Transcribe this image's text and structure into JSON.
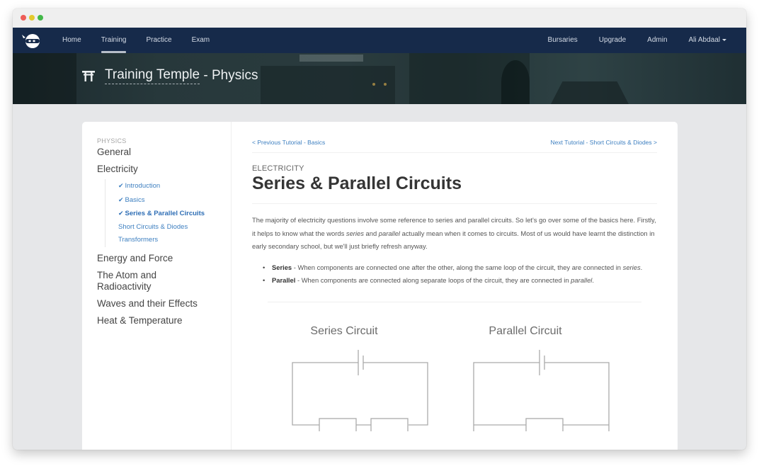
{
  "window": {
    "controls": [
      "close",
      "minimize",
      "maximize"
    ]
  },
  "navbar": {
    "logo": "ninja-logo",
    "left_items": [
      {
        "label": "Home",
        "active": false
      },
      {
        "label": "Training",
        "active": true
      },
      {
        "label": "Practice",
        "active": false
      },
      {
        "label": "Exam",
        "active": false
      }
    ],
    "right_items": [
      {
        "label": "Bursaries"
      },
      {
        "label": "Upgrade"
      },
      {
        "label": "Admin"
      },
      {
        "label": "Ali Abdaal",
        "dropdown": true
      }
    ]
  },
  "banner": {
    "icon": "torii-gate-icon",
    "title_link": "Training Temple",
    "title_suffix": " - Physics"
  },
  "sidebar": {
    "heading": "PHYSICS",
    "topics": [
      {
        "label": "General"
      },
      {
        "label": "Electricity",
        "subitems": [
          {
            "label": "Introduction",
            "completed": true,
            "current": false
          },
          {
            "label": "Basics",
            "completed": true,
            "current": false
          },
          {
            "label": "Series & Parallel Circuits",
            "completed": true,
            "current": true
          },
          {
            "label": "Short Circuits & Diodes",
            "completed": false,
            "current": false
          },
          {
            "label": "Transformers",
            "completed": false,
            "current": false
          }
        ]
      },
      {
        "label": "Energy and Force"
      },
      {
        "label": "The Atom and Radioactivity"
      },
      {
        "label": "Waves and their Effects"
      },
      {
        "label": "Heat & Temperature"
      }
    ],
    "check_glyph": "✔"
  },
  "content": {
    "prev_link": "< Previous Tutorial - Basics",
    "next_link": "Next Tutorial - Short Circuits & Diodes >",
    "overline": "ELECTRICITY",
    "title": "Series & Parallel Circuits",
    "intro": {
      "part1": "The majority of electricity questions involve some reference to series and parallel circuits. So let's go over some of the basics here. Firstly, it helps to know what the words ",
      "em1": "series",
      "part2": " and ",
      "em2": "parallel",
      "part3": " actually mean when it comes to circuits. Most of us would have learnt the distinction in early secondary school, but we'll just briefly refresh anyway."
    },
    "bullets": [
      {
        "term": "Series",
        "text": " - When components are connected one after the other, along the same loop of the circuit, they are connected in ",
        "em": "series",
        "end": "."
      },
      {
        "term": "Parallel",
        "text": " - When components are connected along separate loops of the circuit, they are connected in ",
        "em": "parallel",
        "end": "."
      }
    ],
    "diagrams": [
      {
        "title": "Series Circuit",
        "type": "series"
      },
      {
        "title": "Parallel Circuit",
        "type": "parallel"
      }
    ]
  }
}
